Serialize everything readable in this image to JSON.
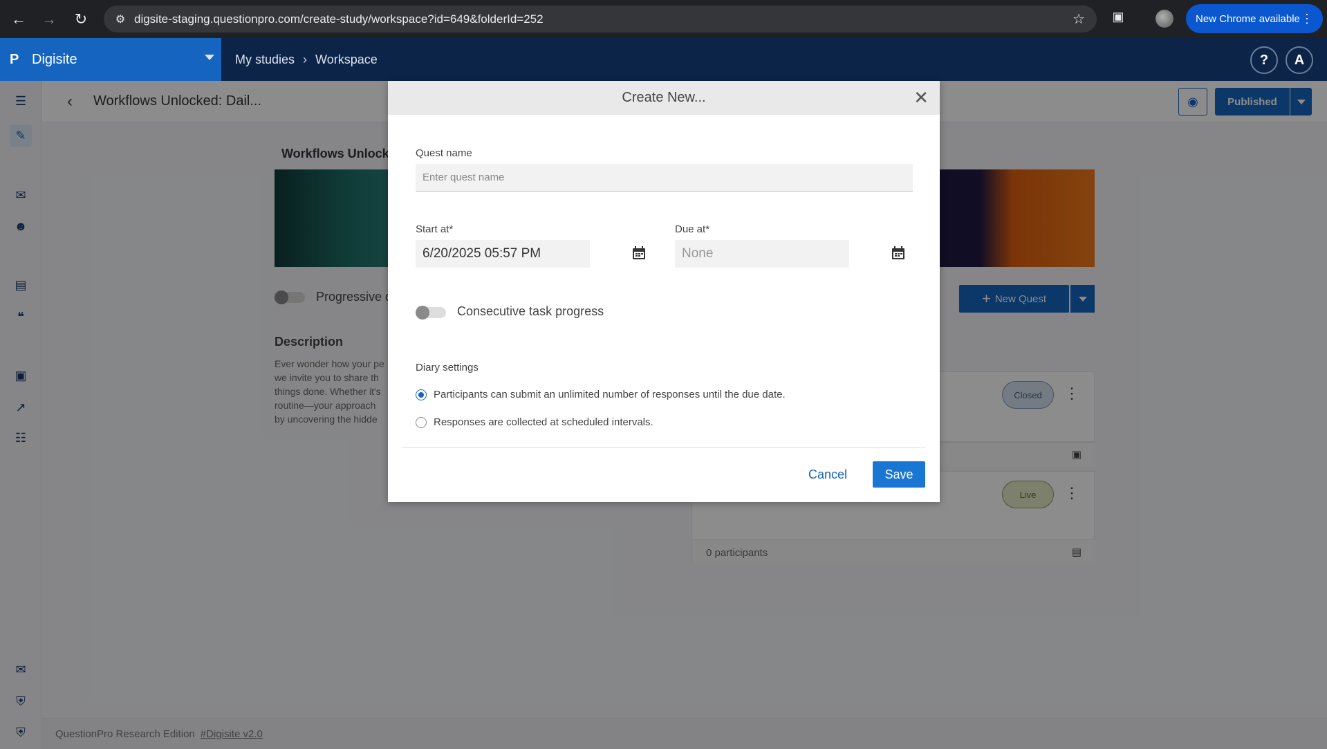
{
  "browser": {
    "url": "digsite-staging.questionpro.com/create-study/workspace?id=649&folderId=252",
    "update_label": "New Chrome available"
  },
  "app": {
    "brand": "Digisite",
    "breadcrumb": [
      "My studies",
      "Workspace"
    ],
    "help_label": "?",
    "avatar_label": "A"
  },
  "toolbar": {
    "study_title": "Workflows Unlocked: Dail...",
    "publish_label": "Published"
  },
  "page": {
    "study_heading": "Workflows Unlocke",
    "progressive_label": "Progressive q",
    "description_heading": "Description",
    "description_text": "Ever wonder how your pe we invite you to share th things done. Whether it's routine—your approach by uncovering the hidde",
    "new_quest_label": "New Quest",
    "quest_cards": [
      {
        "status": "Closed"
      },
      {
        "status": "Live",
        "participants": "0 participants"
      }
    ]
  },
  "footer": {
    "edition": "QuestionPro Research Edition",
    "tag": "#Digisite v2.0"
  },
  "modal": {
    "title": "Create New...",
    "quest_name_label": "Quest name",
    "quest_name_placeholder": "Enter quest name",
    "start_label": "Start at*",
    "start_value": "6/20/2025 05:57 PM",
    "due_label": "Due at*",
    "due_value": "None",
    "consecutive_label": "Consecutive task progress",
    "consecutive_enabled": false,
    "diary_heading": "Diary settings",
    "diary_options": [
      "Participants can submit an unlimited number of responses until the due date.",
      "Responses are collected at scheduled intervals."
    ],
    "diary_selected": 0,
    "cancel_label": "Cancel",
    "save_label": "Save"
  },
  "colors": {
    "primary": "#1565c0",
    "header": "#0b2447",
    "closed_pill": "#d6e1ee",
    "live_pill": "#e3ebc5"
  }
}
